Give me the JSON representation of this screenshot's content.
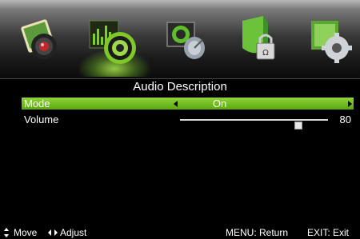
{
  "menu": {
    "icons": [
      {
        "name": "picture-icon"
      },
      {
        "name": "sound-icon",
        "selected": true
      },
      {
        "name": "channel-icon"
      },
      {
        "name": "lock-icon"
      },
      {
        "name": "setup-icon"
      }
    ]
  },
  "page": {
    "title": "Audio Description"
  },
  "rows": [
    {
      "label": "Mode",
      "value": "On"
    },
    {
      "label": "Volume",
      "value": "80",
      "level": 0.8
    }
  ],
  "footer": {
    "move": "Move",
    "adjust": "Adjust",
    "menu_return": "MENU: Return",
    "exit": "EXIT: Exit"
  },
  "colors": {
    "highlight": "#7ac225",
    "background": "#000000"
  }
}
